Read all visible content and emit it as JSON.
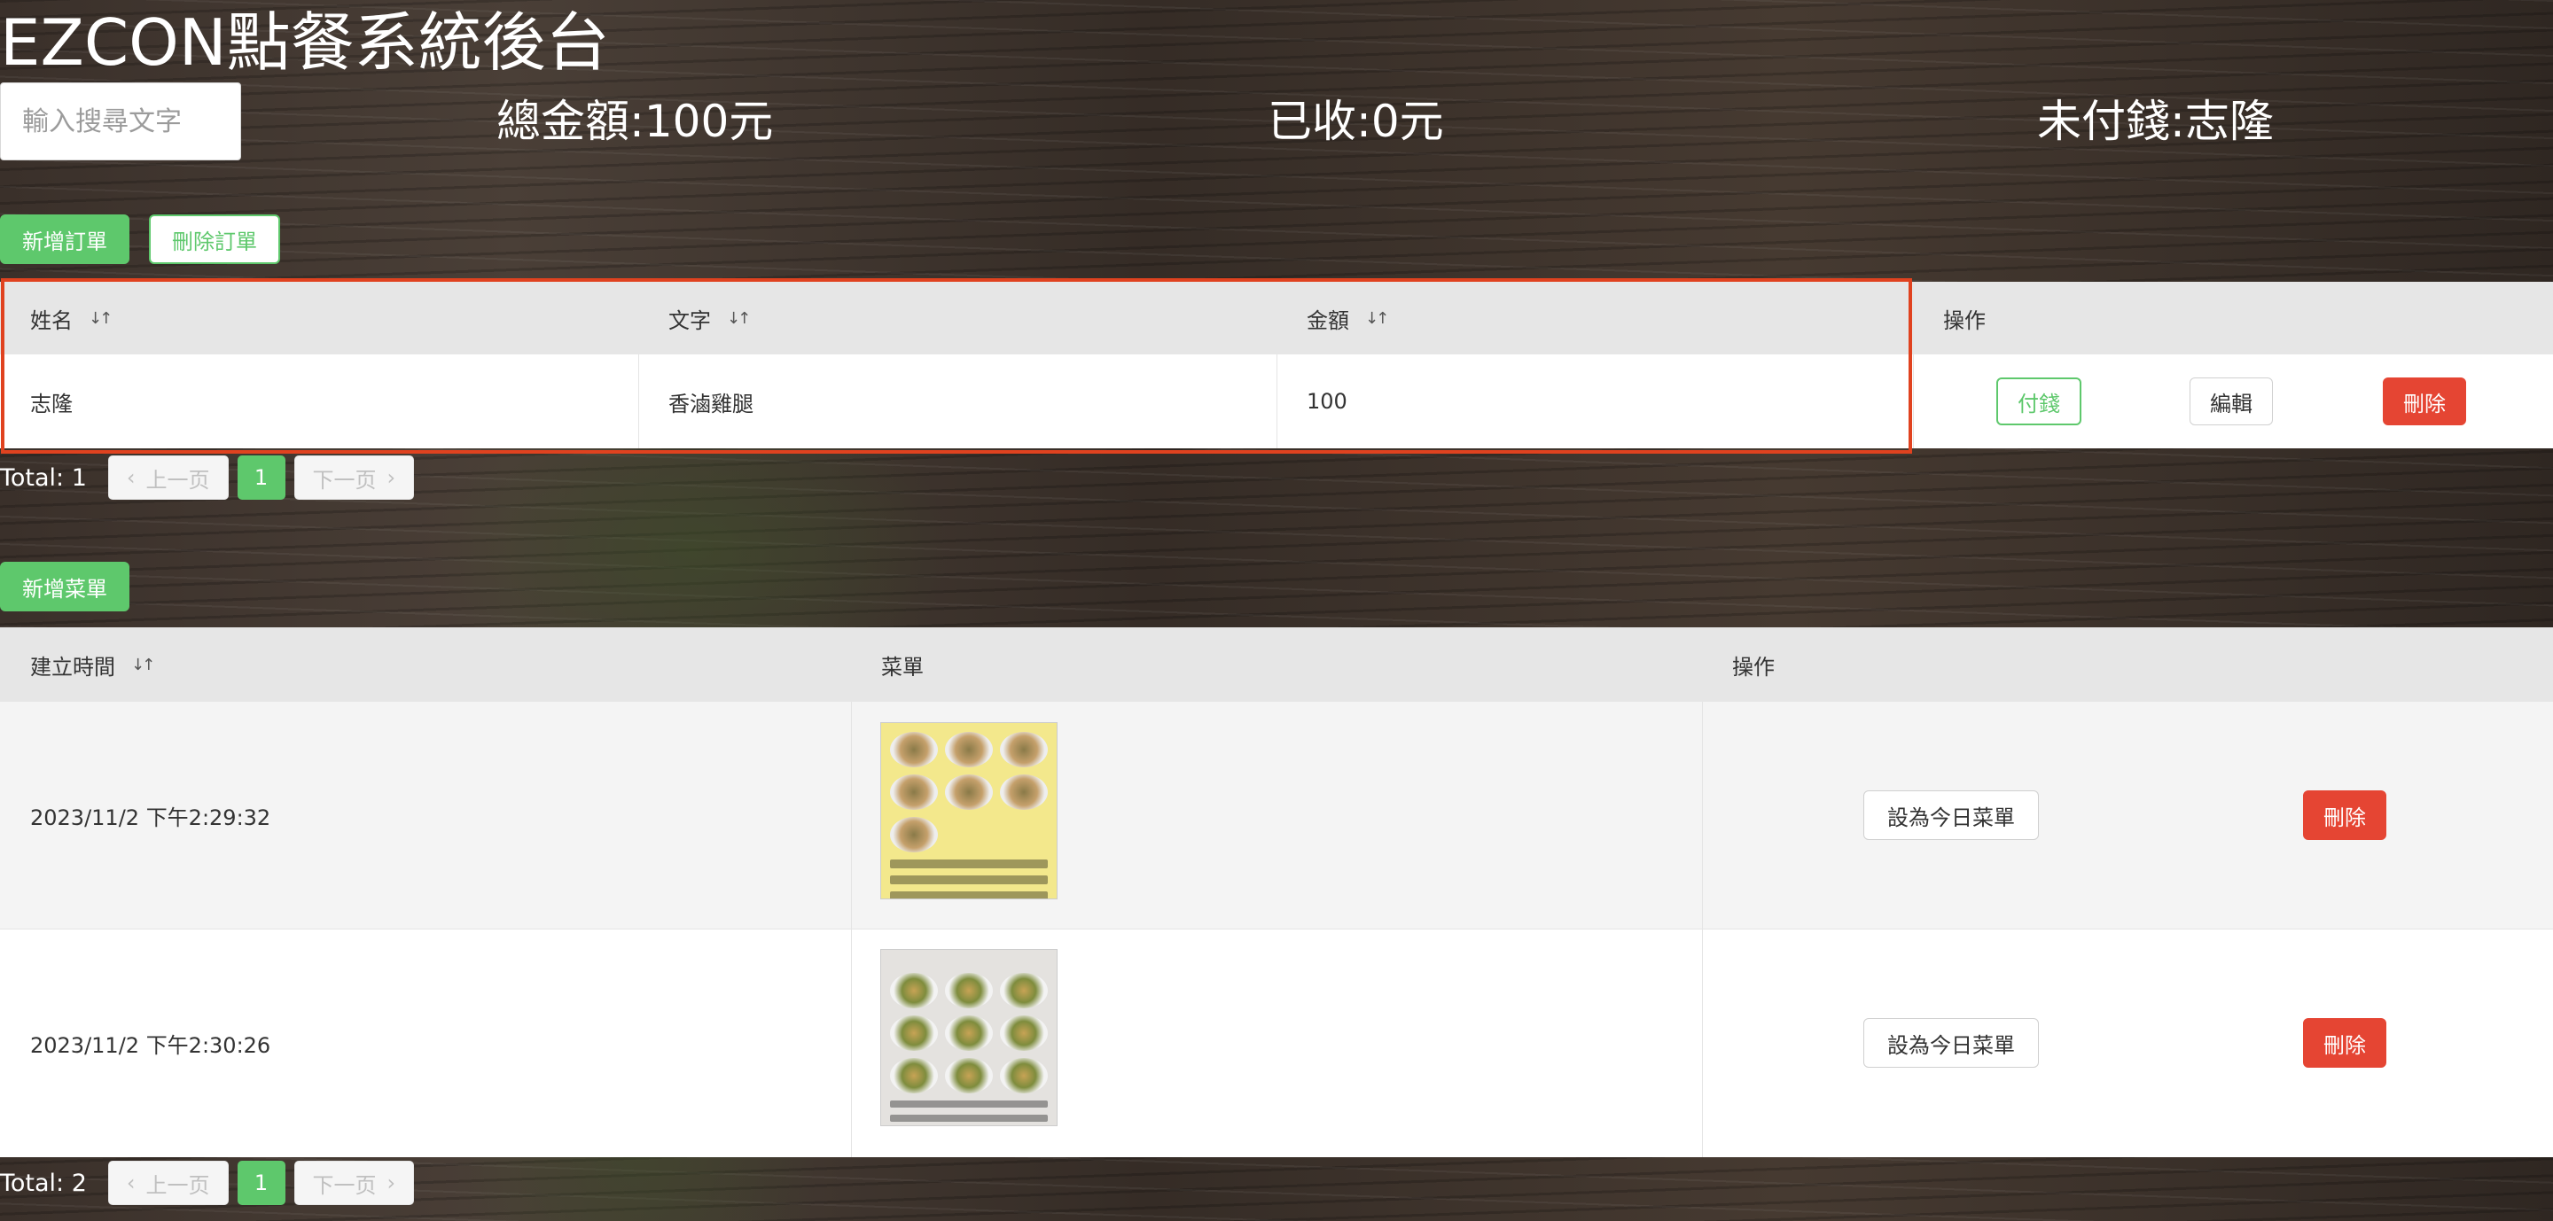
{
  "app_title": "EZCON點餐系統後台",
  "search": {
    "placeholder": "輸入搜尋文字"
  },
  "stats": {
    "total": "總金額:100元",
    "received": "已收:0元",
    "unpaid": "未付錢:志隆"
  },
  "orders": {
    "add_label": "新增訂單",
    "delete_label": "刪除訂單",
    "columns": {
      "name": "姓名",
      "text": "文字",
      "amount": "金額",
      "actions": "操作"
    },
    "rows": [
      {
        "name": "志隆",
        "text": "香滷雞腿",
        "amount": "100",
        "pay": "付錢",
        "edit": "編輯",
        "delete": "刪除"
      }
    ],
    "pager": {
      "total": "Total: 1",
      "prev": "上一页",
      "page": "1",
      "next": "下一页"
    }
  },
  "menus": {
    "add_label": "新增菜單",
    "columns": {
      "created": "建立時間",
      "menu": "菜單",
      "actions": "操作"
    },
    "rows": [
      {
        "created": "2023/11/2 下午2:29:32",
        "set_today": "設為今日菜單",
        "delete": "刪除"
      },
      {
        "created": "2023/11/2 下午2:30:26",
        "set_today": "設為今日菜單",
        "delete": "刪除"
      }
    ],
    "pager": {
      "total": "Total: 2",
      "prev": "上一页",
      "page": "1",
      "next": "下一页"
    }
  },
  "icons": {
    "sort": "sort-icon",
    "prev": "chevron-left-icon",
    "next": "chevron-right-icon"
  },
  "colors": {
    "accent": "#5ec86c",
    "danger": "#e54533",
    "highlight": "#e0421f",
    "header_bg": "#e6e6e6"
  }
}
